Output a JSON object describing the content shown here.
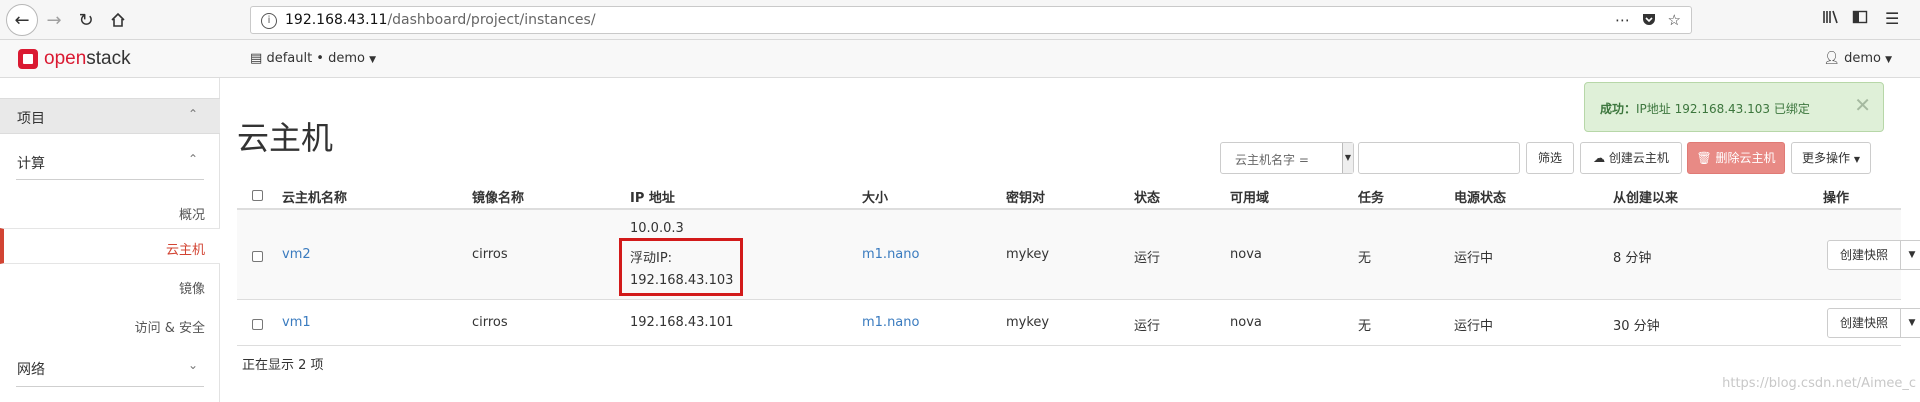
{
  "browser": {
    "url_host": "192.168.43.11",
    "url_path": "/dashboard/project/instances/",
    "more_icon": "more-dots-icon",
    "pocket_icon": "pocket-icon",
    "bookmark_icon": "star-icon"
  },
  "topnav": {
    "logo_prefix": "open",
    "logo_suffix": "stack",
    "project": "default • demo",
    "user": "demo"
  },
  "sidebar": {
    "project": "项目",
    "compute": "计算",
    "items": [
      "概况",
      "云主机",
      "镜像",
      "访问 & 安全"
    ],
    "network": "网络"
  },
  "page": {
    "title": "云主机"
  },
  "alert": {
    "title": "成功：",
    "message": "IP地址 192.168.43.103 已绑定"
  },
  "toolbar": {
    "filter_field": "云主机名字 =",
    "filter_value": "",
    "filter_button": "筛选",
    "create_button": "创建云主机",
    "delete_button": "删除云主机",
    "more_button": "更多操作"
  },
  "table": {
    "headers": [
      "云主机名称",
      "镜像名称",
      "IP 地址",
      "大小",
      "密钥对",
      "状态",
      "可用域",
      "任务",
      "电源状态",
      "从创建以来",
      "操作"
    ],
    "rows": [
      {
        "name": "vm2",
        "image": "cirros",
        "ip_fixed": "10.0.0.3",
        "ip_float_label": "浮动IP:",
        "ip_float": "192.168.43.103",
        "size": "m1.nano",
        "keypair": "mykey",
        "status": "运行",
        "zone": "nova",
        "task": "无",
        "power": "运行中",
        "age": "8 分钟",
        "action": "创建快照"
      },
      {
        "name": "vm1",
        "image": "cirros",
        "ip": "192.168.43.101",
        "size": "m1.nano",
        "keypair": "mykey",
        "status": "运行",
        "zone": "nova",
        "task": "无",
        "power": "运行中",
        "age": "30 分钟",
        "action": "创建快照"
      }
    ],
    "count_text": "正在显示 2 项"
  },
  "watermark": "https://blog.csdn.net/Aimee_c"
}
